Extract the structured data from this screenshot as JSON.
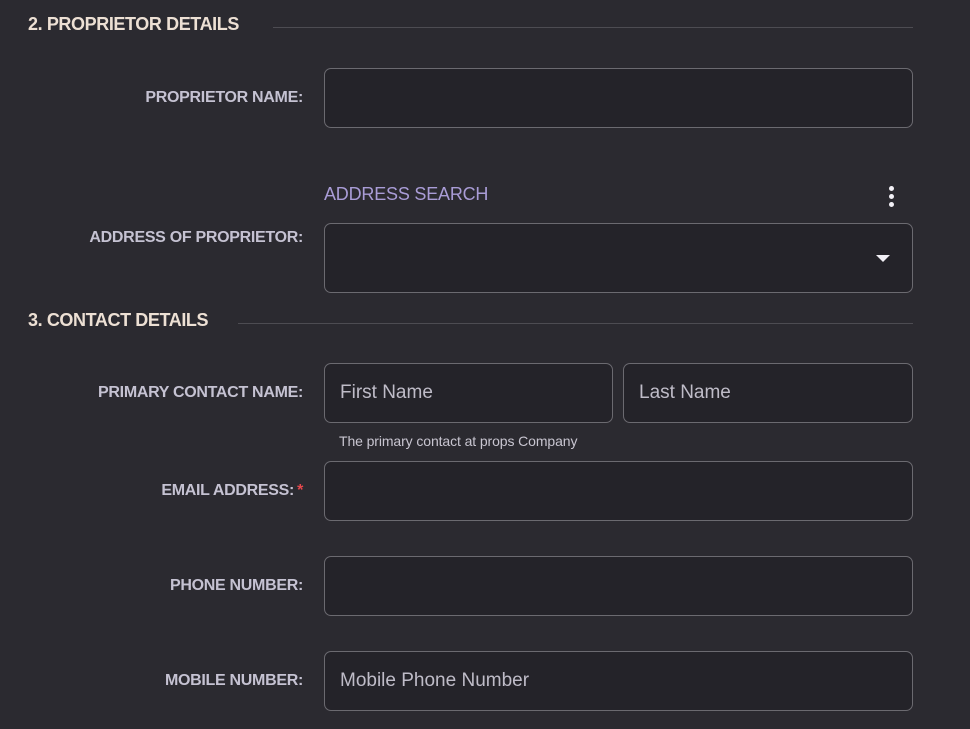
{
  "sections": {
    "proprietor": {
      "title": "2. PROPRIETOR DETAILS",
      "name_label": "PROPRIETOR NAME:",
      "name_value": "",
      "address_search_label": "ADDRESS SEARCH",
      "address_label": "ADDRESS OF PROPRIETOR:",
      "address_value": ""
    },
    "contact": {
      "title": "3. CONTACT DETAILS",
      "primary_label": "PRIMARY CONTACT NAME:",
      "first_name_placeholder": "First Name",
      "last_name_placeholder": "Last Name",
      "primary_helper": "The primary contact at props Company",
      "email_label": "EMAIL ADDRESS:",
      "email_required_mark": "*",
      "email_value": "",
      "phone_label": "PHONE NUMBER:",
      "phone_value": "",
      "mobile_label": "MOBILE NUMBER:",
      "mobile_placeholder": "Mobile Phone Number"
    }
  },
  "icons": {
    "more": "more-vertical-icon",
    "dropdown": "caret-down-icon"
  },
  "colors": {
    "background": "#2b2a30",
    "input_background": "#242329",
    "input_border": "#6b6a70",
    "section_title": "#ede0d4",
    "label": "#c5c2d2",
    "accent_label": "#a99cd6",
    "required": "#e5484d"
  }
}
